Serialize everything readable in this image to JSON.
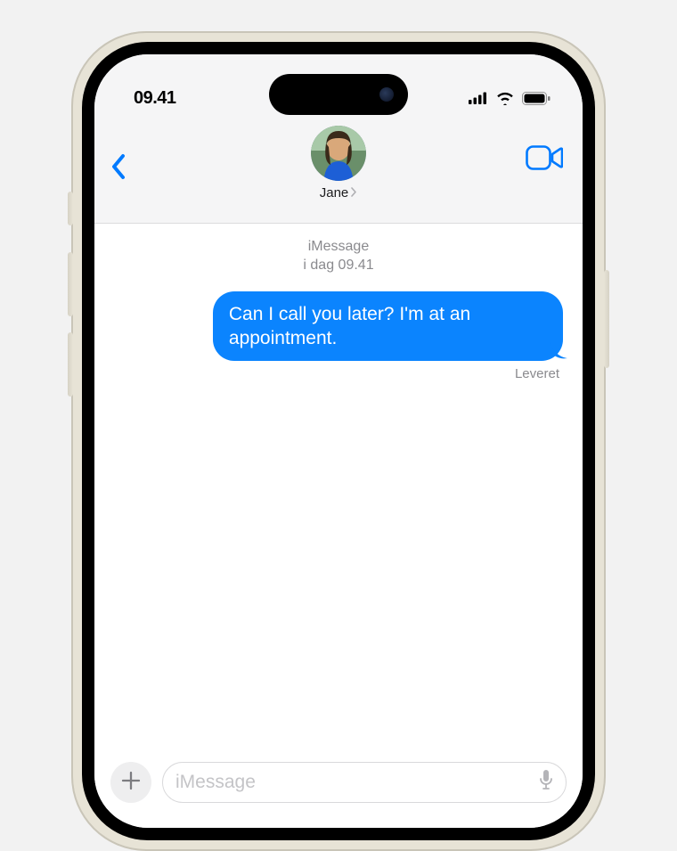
{
  "status": {
    "time": "09.41"
  },
  "header": {
    "contact_name": "Jane"
  },
  "thread": {
    "service": "iMessage",
    "timestamp": "i dag 09.41"
  },
  "messages": [
    {
      "text": "Can I call you later? I'm at an appointment.",
      "sent": true,
      "status": "Leveret"
    }
  ],
  "input": {
    "placeholder": "iMessage"
  },
  "colors": {
    "accent": "#007aff",
    "bubble_sent": "#0b84fe"
  }
}
